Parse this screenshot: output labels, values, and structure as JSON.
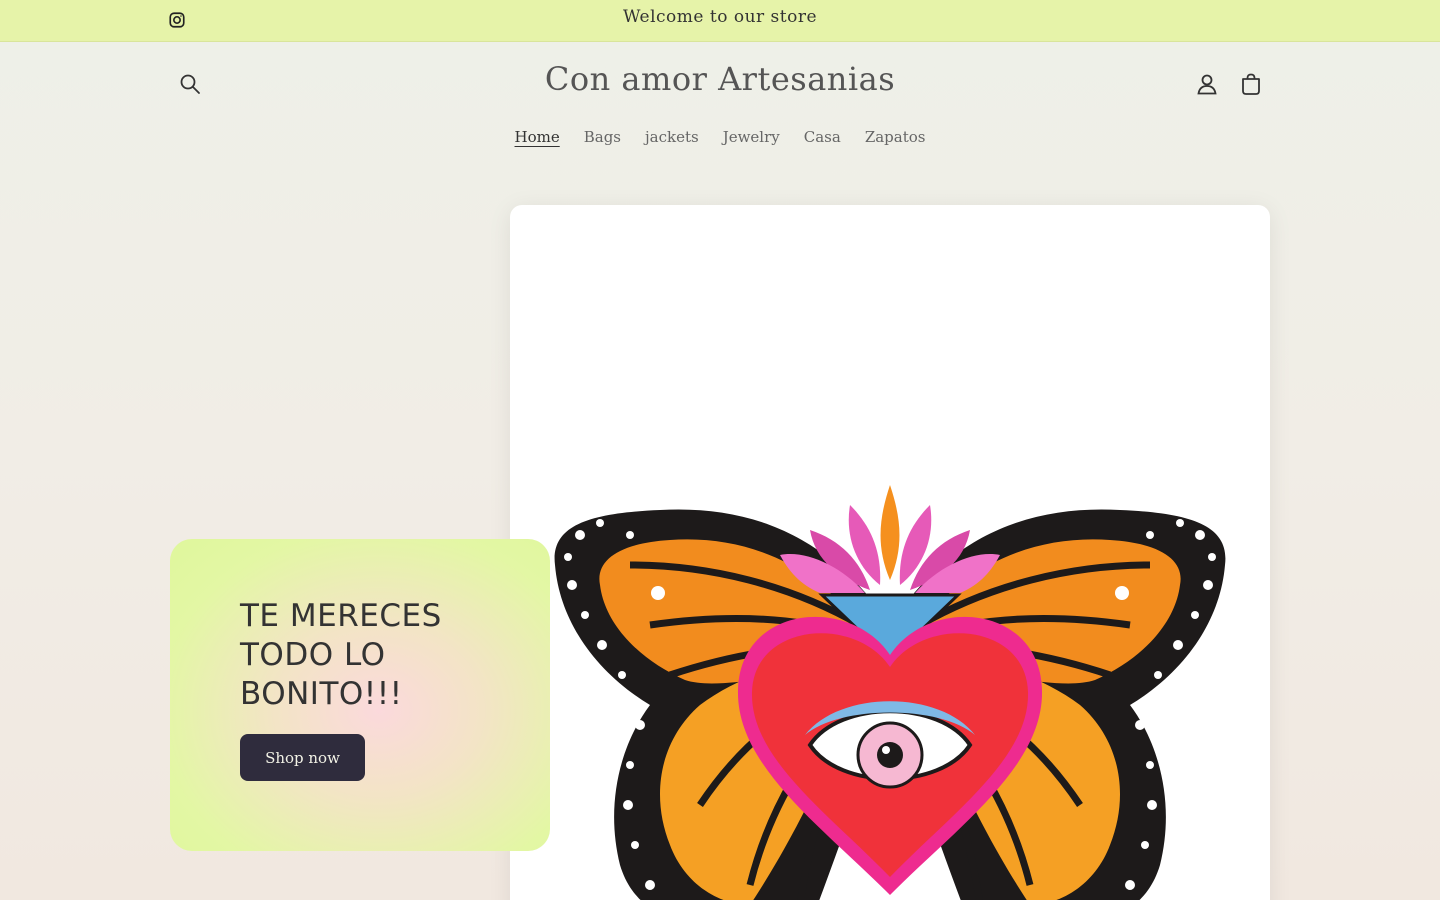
{
  "announcement": {
    "message": "Welcome to our store",
    "social_icon": "instagram-icon"
  },
  "header": {
    "brand": "Con amor Artesanias",
    "search_icon": "search-icon",
    "account_icon": "account-icon",
    "cart_icon": "cart-icon"
  },
  "nav": {
    "items": [
      {
        "label": "Home",
        "active": true
      },
      {
        "label": "Bags",
        "active": false
      },
      {
        "label": "jackets",
        "active": false
      },
      {
        "label": "Jewelry",
        "active": false
      },
      {
        "label": "Casa",
        "active": false
      },
      {
        "label": "Zapatos",
        "active": false
      }
    ]
  },
  "hero": {
    "heading": "TE MERECES TODO LO BONITO!!!",
    "button_label": "Shop now",
    "image": "butterfly-heart-illustration"
  },
  "colors": {
    "announcement_bg": "#e6f3a9",
    "button_bg": "#2f2c3d",
    "card_green": "#dff79c",
    "card_pink": "#fbd9dc"
  }
}
